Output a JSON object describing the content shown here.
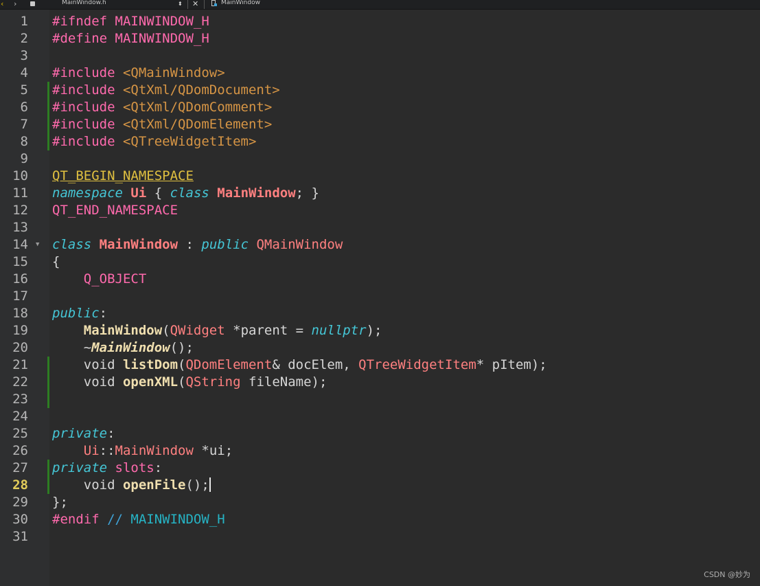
{
  "toolbar": {
    "file_name": "MainWindow.h",
    "symbol_name": "MainWindow"
  },
  "editor": {
    "current_line": 28,
    "modified_lines": [
      5,
      6,
      7,
      8,
      21,
      22,
      23,
      27,
      28
    ],
    "lines": [
      {
        "n": "1",
        "t": [
          [
            "pp",
            "#ifndef MAINWINDOW_H"
          ]
        ]
      },
      {
        "n": "2",
        "t": [
          [
            "pp",
            "#define MAINWINDOW_H"
          ]
        ]
      },
      {
        "n": "3",
        "t": []
      },
      {
        "n": "4",
        "t": [
          [
            "pp",
            "#include "
          ],
          [
            "inc",
            "<QMainWindow>"
          ]
        ]
      },
      {
        "n": "5",
        "t": [
          [
            "pp",
            "#include "
          ],
          [
            "inc",
            "<QtXml/QDomDocument>"
          ]
        ]
      },
      {
        "n": "6",
        "t": [
          [
            "pp",
            "#include "
          ],
          [
            "inc",
            "<QtXml/QDomComment>"
          ]
        ]
      },
      {
        "n": "7",
        "t": [
          [
            "pp",
            "#include "
          ],
          [
            "inc",
            "<QtXml/QDomElement>"
          ]
        ]
      },
      {
        "n": "8",
        "t": [
          [
            "pp",
            "#include "
          ],
          [
            "inc",
            "<QTreeWidgetItem>"
          ]
        ]
      },
      {
        "n": "9",
        "t": []
      },
      {
        "n": "10",
        "t": [
          [
            "macu",
            "QT_BEGIN_NAMESPACE"
          ]
        ]
      },
      {
        "n": "11",
        "t": [
          [
            "kw",
            "namespace"
          ],
          [
            "plain",
            " "
          ],
          [
            "ns",
            "Ui"
          ],
          [
            "plain",
            " { "
          ],
          [
            "kw",
            "class"
          ],
          [
            "plain",
            " "
          ],
          [
            "typb",
            "MainWindow"
          ],
          [
            "plain",
            "; }"
          ]
        ]
      },
      {
        "n": "12",
        "t": [
          [
            "mac",
            "QT_END_NAMESPACE"
          ]
        ]
      },
      {
        "n": "13",
        "t": []
      },
      {
        "n": "14",
        "t": [
          [
            "kw",
            "class"
          ],
          [
            "plain",
            " "
          ],
          [
            "typb",
            "MainWindow"
          ],
          [
            "plain",
            " : "
          ],
          [
            "kw",
            "public"
          ],
          [
            "plain",
            " "
          ],
          [
            "typ",
            "QMainWindow"
          ]
        ],
        "fold": true
      },
      {
        "n": "15",
        "t": [
          [
            "plain",
            "{"
          ]
        ]
      },
      {
        "n": "16",
        "t": [
          [
            "plain",
            "    "
          ],
          [
            "mac",
            "Q_OBJECT"
          ]
        ]
      },
      {
        "n": "17",
        "t": []
      },
      {
        "n": "18",
        "t": [
          [
            "kw",
            "public"
          ],
          [
            "plain",
            ":"
          ]
        ]
      },
      {
        "n": "19",
        "t": [
          [
            "plain",
            "    "
          ],
          [
            "fn",
            "MainWindow"
          ],
          [
            "plain",
            "("
          ],
          [
            "typ",
            "QWidget"
          ],
          [
            "plain",
            " *parent = "
          ],
          [
            "kw",
            "nullptr"
          ],
          [
            "plain",
            ");"
          ]
        ]
      },
      {
        "n": "20",
        "t": [
          [
            "plain",
            "    ~"
          ],
          [
            "fni",
            "MainWindow"
          ],
          [
            "plain",
            "();"
          ]
        ]
      },
      {
        "n": "21",
        "t": [
          [
            "plain",
            "    void "
          ],
          [
            "fn",
            "listDom"
          ],
          [
            "plain",
            "("
          ],
          [
            "typ",
            "QDomElement"
          ],
          [
            "plain",
            "& docElem, "
          ],
          [
            "typ",
            "QTreeWidgetItem"
          ],
          [
            "plain",
            "* pItem);"
          ]
        ]
      },
      {
        "n": "22",
        "t": [
          [
            "plain",
            "    void "
          ],
          [
            "fn",
            "openXML"
          ],
          [
            "plain",
            "("
          ],
          [
            "typ",
            "QString"
          ],
          [
            "plain",
            " fileName);"
          ]
        ]
      },
      {
        "n": "23",
        "t": []
      },
      {
        "n": "24",
        "t": []
      },
      {
        "n": "25",
        "t": [
          [
            "kw",
            "private"
          ],
          [
            "plain",
            ":"
          ]
        ]
      },
      {
        "n": "26",
        "t": [
          [
            "plain",
            "    "
          ],
          [
            "typ",
            "Ui"
          ],
          [
            "plain",
            "::"
          ],
          [
            "typ",
            "MainWindow"
          ],
          [
            "plain",
            " *ui;"
          ]
        ]
      },
      {
        "n": "27",
        "t": [
          [
            "kw",
            "private"
          ],
          [
            "plain",
            " "
          ],
          [
            "pp",
            "slots"
          ],
          [
            "plain",
            ":"
          ]
        ]
      },
      {
        "n": "28",
        "t": [
          [
            "plain",
            "    void "
          ],
          [
            "fn",
            "openFile"
          ],
          [
            "plain",
            "();"
          ]
        ],
        "cursor": true
      },
      {
        "n": "29",
        "t": [
          [
            "plain",
            "};"
          ]
        ]
      },
      {
        "n": "30",
        "t": [
          [
            "pp",
            "#endif"
          ],
          [
            "plain",
            " "
          ],
          [
            "cm",
            "// "
          ],
          [
            "cmt",
            "MAINWINDOW_H"
          ]
        ]
      },
      {
        "n": "31",
        "t": []
      }
    ]
  },
  "watermark": "CSDN @妙为"
}
